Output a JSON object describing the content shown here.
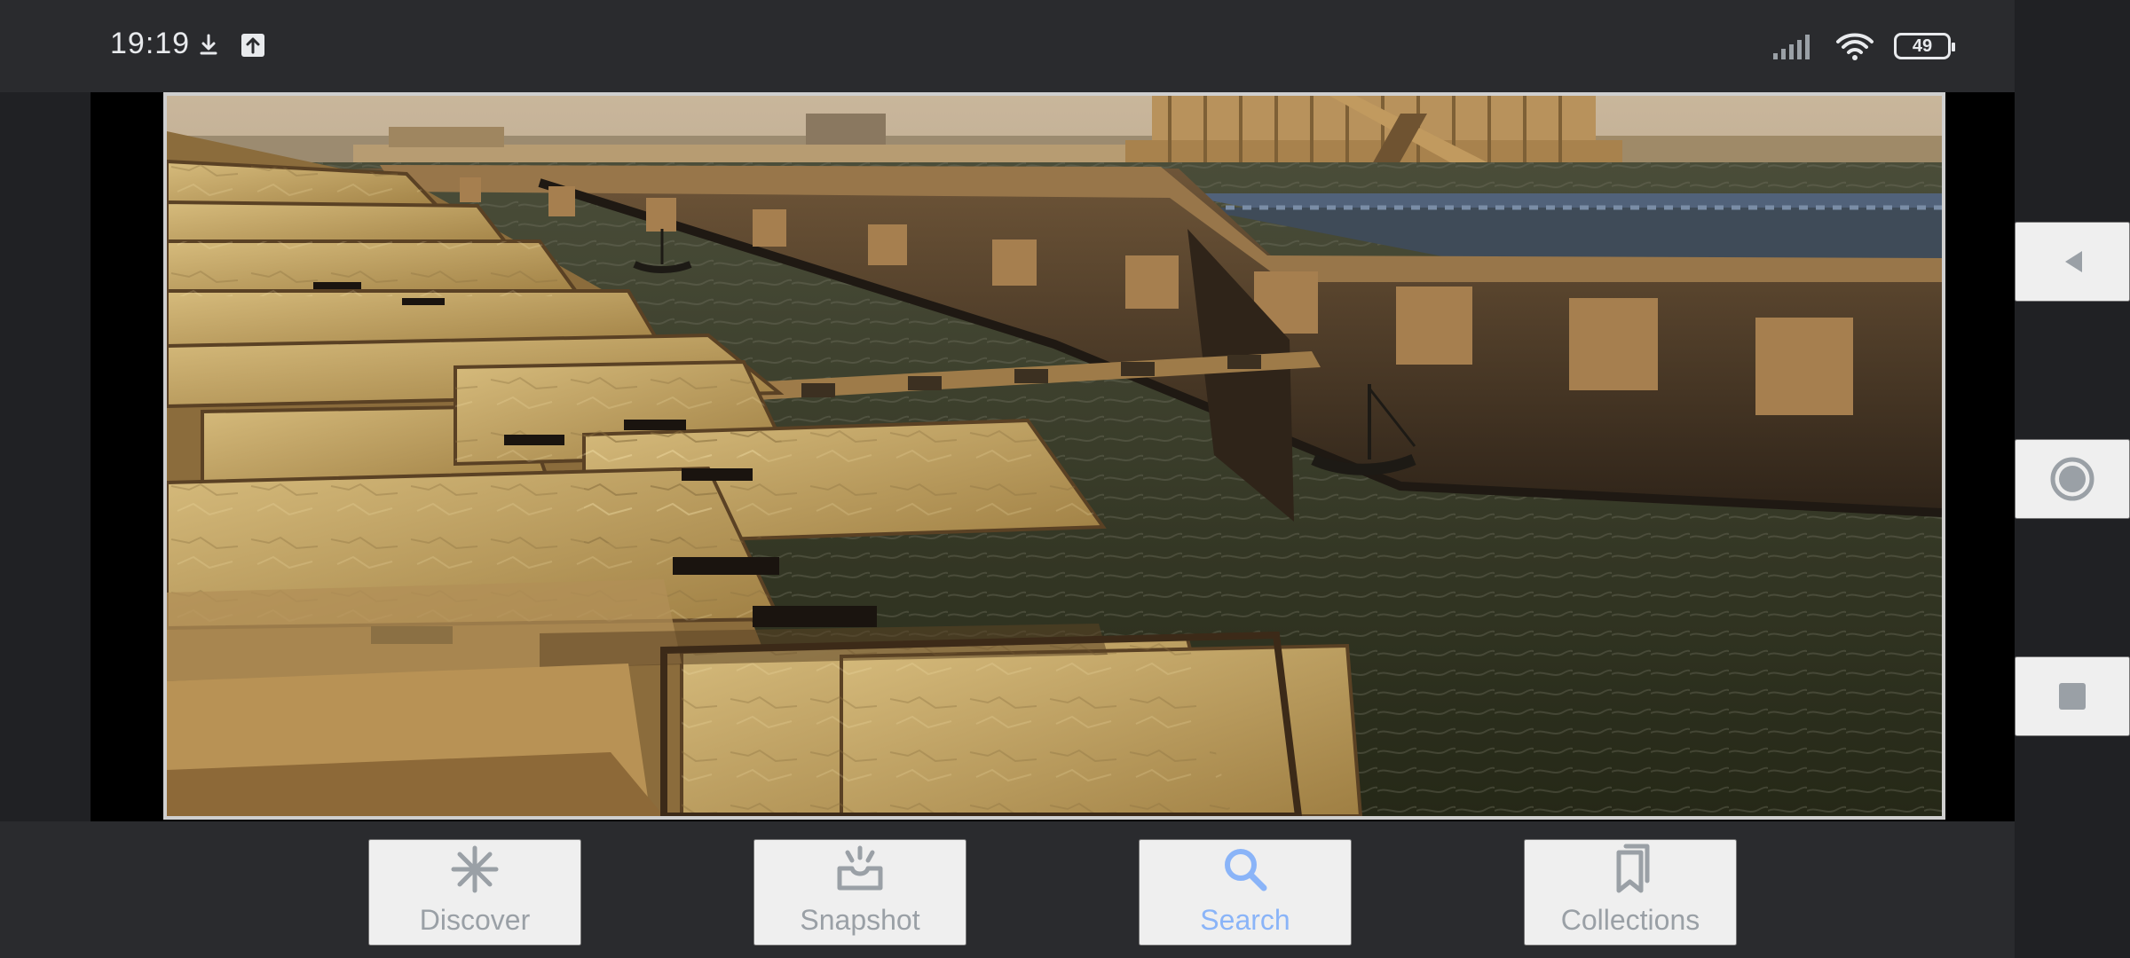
{
  "status_bar": {
    "time": "19:19",
    "battery": "49",
    "icons": [
      "download-icon",
      "upload-icon",
      "signal-icon",
      "wifi-icon",
      "battery-icon"
    ]
  },
  "viewer": {
    "content": "image"
  },
  "bottom_nav": {
    "items": [
      {
        "label": "Discover",
        "icon": "asterisk-icon",
        "active": false
      },
      {
        "label": "Snapshot",
        "icon": "snapshot-icon",
        "active": false
      },
      {
        "label": "Search",
        "icon": "search-icon",
        "active": true
      },
      {
        "label": "Collections",
        "icon": "collections-icon",
        "active": false
      }
    ]
  },
  "colors": {
    "background": "#202124",
    "bar": "#2a2b2e",
    "inactive": "#9aa0a6",
    "active": "#8ab4f8"
  },
  "android_nav": {
    "icons": [
      "back-icon",
      "home-icon",
      "recents-icon"
    ]
  }
}
